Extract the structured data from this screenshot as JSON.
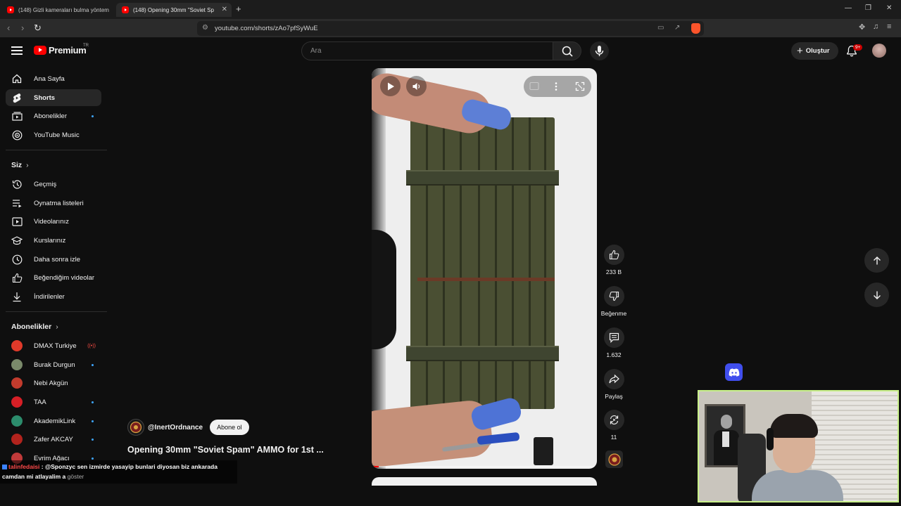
{
  "browser": {
    "tabs": [
      {
        "title": "(148) Gizli kameraları bulma yöntem"
      },
      {
        "title": "(148) Opening 30mm \"Soviet Sp"
      }
    ],
    "url": "youtube.com/shorts/zAo7pfSyWuE"
  },
  "header": {
    "logo_text": "Premium",
    "country": "TR",
    "search_placeholder": "Ara",
    "create_label": "Oluştur",
    "notif_count": "9+"
  },
  "sidebar": {
    "main": [
      {
        "label": "Ana Sayfa",
        "icon": "home-icon"
      },
      {
        "label": "Shorts",
        "icon": "shorts-icon"
      },
      {
        "label": "Abonelikler",
        "icon": "subscriptions-icon"
      },
      {
        "label": "YouTube Music",
        "icon": "music-icon"
      }
    ],
    "you_title": "Siz",
    "you": [
      {
        "label": "Geçmiş",
        "icon": "history-icon"
      },
      {
        "label": "Oynatma listeleri",
        "icon": "playlist-icon"
      },
      {
        "label": "Videolarınız",
        "icon": "your-videos-icon"
      },
      {
        "label": "Kurslarınız",
        "icon": "courses-icon"
      },
      {
        "label": "Daha sonra izle",
        "icon": "watch-later-icon"
      },
      {
        "label": "Beğendiğim videolar",
        "icon": "liked-icon"
      },
      {
        "label": "İndirilenler",
        "icon": "download-icon"
      }
    ],
    "subs_title": "Abonelikler",
    "subs": [
      {
        "name": "DMAX Turkiye",
        "color": "#e03a2a"
      },
      {
        "name": "Burak Durgun",
        "color": "#7a8a6a"
      },
      {
        "name": "Nebi Akgün",
        "color": "#c23b2d"
      },
      {
        "name": "TAA",
        "color": "#d61f26"
      },
      {
        "name": "AkademikLink",
        "color": "#2c8c6c"
      },
      {
        "name": "Zafer AKCAY",
        "color": "#b2231d"
      },
      {
        "name": "Evrim Ağacı",
        "color": "#c03a3a"
      }
    ]
  },
  "short": {
    "channel": "@InertOrdnance",
    "subscribe_label": "Abone ol",
    "title": "Opening 30mm \"Soviet Spam\" AMMO for 1st ...",
    "progress_fraction": 0.03,
    "actions": [
      {
        "label": "233 B",
        "icon": "like-icon"
      },
      {
        "label": "Beğenme",
        "icon": "dislike-icon"
      },
      {
        "label": "1.632",
        "icon": "comment-icon"
      },
      {
        "label": "Paylaş",
        "icon": "share-icon"
      },
      {
        "label": "11",
        "icon": "remix-icon"
      }
    ]
  },
  "chat": {
    "user": "talinfedaisi",
    "message": ": @Sponzyc sen izmirde yasayip bunlari diyosan biz ankarada",
    "message_cont": "camdan mi atlayalim a",
    "more_label": "göster"
  },
  "colors": {
    "accent": "#ff0000",
    "background": "#0f0f0f",
    "webcam_border": "#c8f08a"
  }
}
